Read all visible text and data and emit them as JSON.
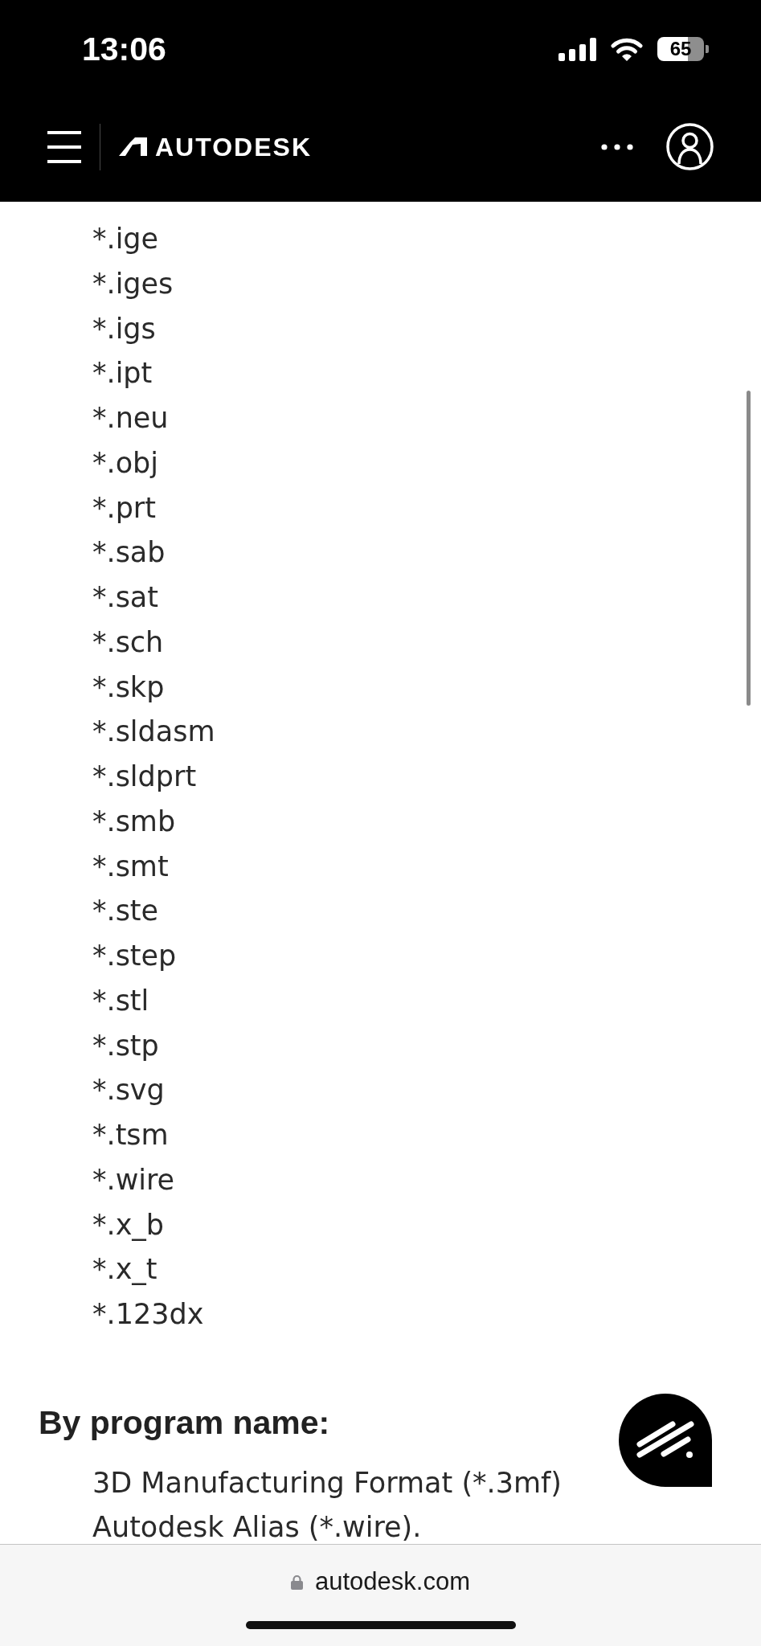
{
  "status_bar": {
    "time": "13:06",
    "battery": "65"
  },
  "header": {
    "logo": "AUTODESK"
  },
  "extension_list": [
    "*.ige",
    "*.iges",
    "*.igs",
    "*.ipt",
    "*.neu",
    "*.obj",
    "*.prt",
    "*.sab",
    "*.sat",
    "*.sch",
    "*.skp",
    "*.sldasm",
    "*.sldprt",
    "*.smb",
    "*.smt",
    "*.ste",
    "*.step",
    "*.stl",
    "*.stp",
    "*.svg",
    "*.tsm",
    "*.wire",
    "*.x_b",
    "*.x_t",
    "*.123dx"
  ],
  "program_section": {
    "heading": "By program name:",
    "items": [
      "3D Manufacturing Format (*.3mf)",
      "Autodesk Alias (*.wire)."
    ]
  },
  "address_bar": {
    "url": "autodesk.com"
  }
}
